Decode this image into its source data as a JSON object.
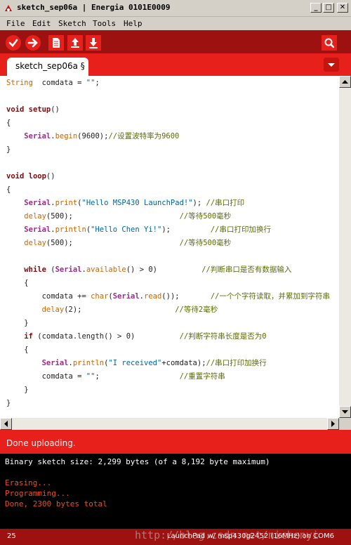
{
  "window": {
    "title": "sketch_sep06a | Energia 0101E0009",
    "controls": {
      "minimize": "_",
      "maximize": "□",
      "close": "✕"
    }
  },
  "menu": [
    "File",
    "Edit",
    "Sketch",
    "Tools",
    "Help"
  ],
  "toolbar": {
    "buttons": [
      "verify-icon",
      "upload-icon",
      "new-icon",
      "open-icon",
      "save-icon",
      "serial-monitor-icon"
    ]
  },
  "tabs": {
    "active": "sketch_sep06a §"
  },
  "code": {
    "lines": [
      [
        [
          "t-type",
          "String"
        ],
        [
          "",
          "  comdata = "
        ],
        [
          "t-str",
          "\"\""
        ],
        [
          "",
          ";"
        ]
      ],
      [],
      [
        [
          "t-kw",
          "void"
        ],
        [
          "",
          " "
        ],
        [
          "t-kw",
          "setup"
        ],
        [
          "",
          "()"
        ]
      ],
      [
        [
          "",
          "{"
        ]
      ],
      [
        [
          "",
          "    "
        ],
        [
          "t-obj",
          "Serial"
        ],
        [
          "",
          "."
        ],
        [
          "t-fn",
          "begin"
        ],
        [
          "",
          "(9600);"
        ],
        [
          "t-cm",
          "//设置波特率为9600"
        ]
      ],
      [
        [
          "",
          "}"
        ]
      ],
      [],
      [
        [
          "t-kw",
          "void"
        ],
        [
          "",
          " "
        ],
        [
          "t-kw",
          "loop"
        ],
        [
          "",
          "()"
        ]
      ],
      [
        [
          "",
          "{"
        ]
      ],
      [
        [
          "",
          "    "
        ],
        [
          "t-obj",
          "Serial"
        ],
        [
          "",
          "."
        ],
        [
          "t-fn",
          "print"
        ],
        [
          "",
          "("
        ],
        [
          "t-str",
          "\"Hello MSP430 LaunchPad!\""
        ],
        [
          "",
          "); "
        ],
        [
          "t-cm",
          "//串口打印"
        ]
      ],
      [
        [
          "",
          "    "
        ],
        [
          "t-fn",
          "delay"
        ],
        [
          "",
          "(500);                        "
        ],
        [
          "t-cm",
          "//等待500毫秒"
        ]
      ],
      [
        [
          "",
          "    "
        ],
        [
          "t-obj",
          "Serial"
        ],
        [
          "",
          "."
        ],
        [
          "t-fn",
          "println"
        ],
        [
          "",
          "("
        ],
        [
          "t-str",
          "\"Hello Chen Yi!\""
        ],
        [
          "",
          ");         "
        ],
        [
          "t-cm",
          "//串口打印加换行"
        ]
      ],
      [
        [
          "",
          "    "
        ],
        [
          "t-fn",
          "delay"
        ],
        [
          "",
          "(500);                        "
        ],
        [
          "t-cm",
          "//等待500毫秒"
        ]
      ],
      [],
      [
        [
          "",
          "    "
        ],
        [
          "t-kw",
          "while"
        ],
        [
          "",
          " ("
        ],
        [
          "t-obj",
          "Serial"
        ],
        [
          "",
          "."
        ],
        [
          "t-fn",
          "available"
        ],
        [
          "",
          "() > 0)          "
        ],
        [
          "t-cm",
          "//判断串口是否有数据输入"
        ]
      ],
      [
        [
          "",
          "    {"
        ]
      ],
      [
        [
          "",
          "        comdata += "
        ],
        [
          "t-fn",
          "char"
        ],
        [
          "",
          "("
        ],
        [
          "t-obj",
          "Serial"
        ],
        [
          "",
          "."
        ],
        [
          "t-fn",
          "read"
        ],
        [
          "",
          "());       "
        ],
        [
          "t-cm",
          "//一个个字符读取，并累加到字符串"
        ]
      ],
      [
        [
          "",
          "        "
        ],
        [
          "t-fn",
          "delay"
        ],
        [
          "",
          "(2);                     "
        ],
        [
          "t-cm",
          "//等待2毫秒"
        ]
      ],
      [
        [
          "",
          "    }"
        ]
      ],
      [
        [
          "",
          "    "
        ],
        [
          "t-kw",
          "if"
        ],
        [
          "",
          " (comdata.length() > 0)          "
        ],
        [
          "t-cm",
          "//判断字符串长度是否为0"
        ]
      ],
      [
        [
          "",
          "    {"
        ]
      ],
      [
        [
          "",
          "        "
        ],
        [
          "t-obj",
          "Serial"
        ],
        [
          "",
          "."
        ],
        [
          "t-fn",
          "println"
        ],
        [
          "",
          "("
        ],
        [
          "t-str",
          "\"I received\""
        ],
        [
          "",
          "+comdata);"
        ],
        [
          "t-cm",
          "//串口打印加换行"
        ]
      ],
      [
        [
          "",
          "        comdata = "
        ],
        [
          "t-str",
          "\"\""
        ],
        [
          "",
          ";                  "
        ],
        [
          "t-cm",
          "//重置字符串"
        ]
      ],
      [
        [
          "",
          "    }"
        ]
      ],
      [
        [
          "",
          "}"
        ]
      ]
    ]
  },
  "status": {
    "message": "Done uploading."
  },
  "console": {
    "lines": [
      {
        "text": "Binary sketch size: 2,299 bytes (of a 8,192 byte maximum)",
        "color": "#ffffff"
      },
      {
        "text": "",
        "color": "#ffffff"
      },
      {
        "text": "Erasing...",
        "color": "#e8501c"
      },
      {
        "text": "Programming...",
        "color": "#e8501c"
      },
      {
        "text": "Done, 2300 bytes total",
        "color": "#e8501c"
      }
    ]
  },
  "footer": {
    "line_number": "25",
    "board": "LaunchPad w/ msp430g2452 (16MHz) on COM6",
    "watermark": "http://blog.csdn.net/nichenyi"
  },
  "colors": {
    "toolbar_bg": "#9e1111",
    "accent_red": "#e8201c",
    "console_orange": "#e8501c"
  }
}
